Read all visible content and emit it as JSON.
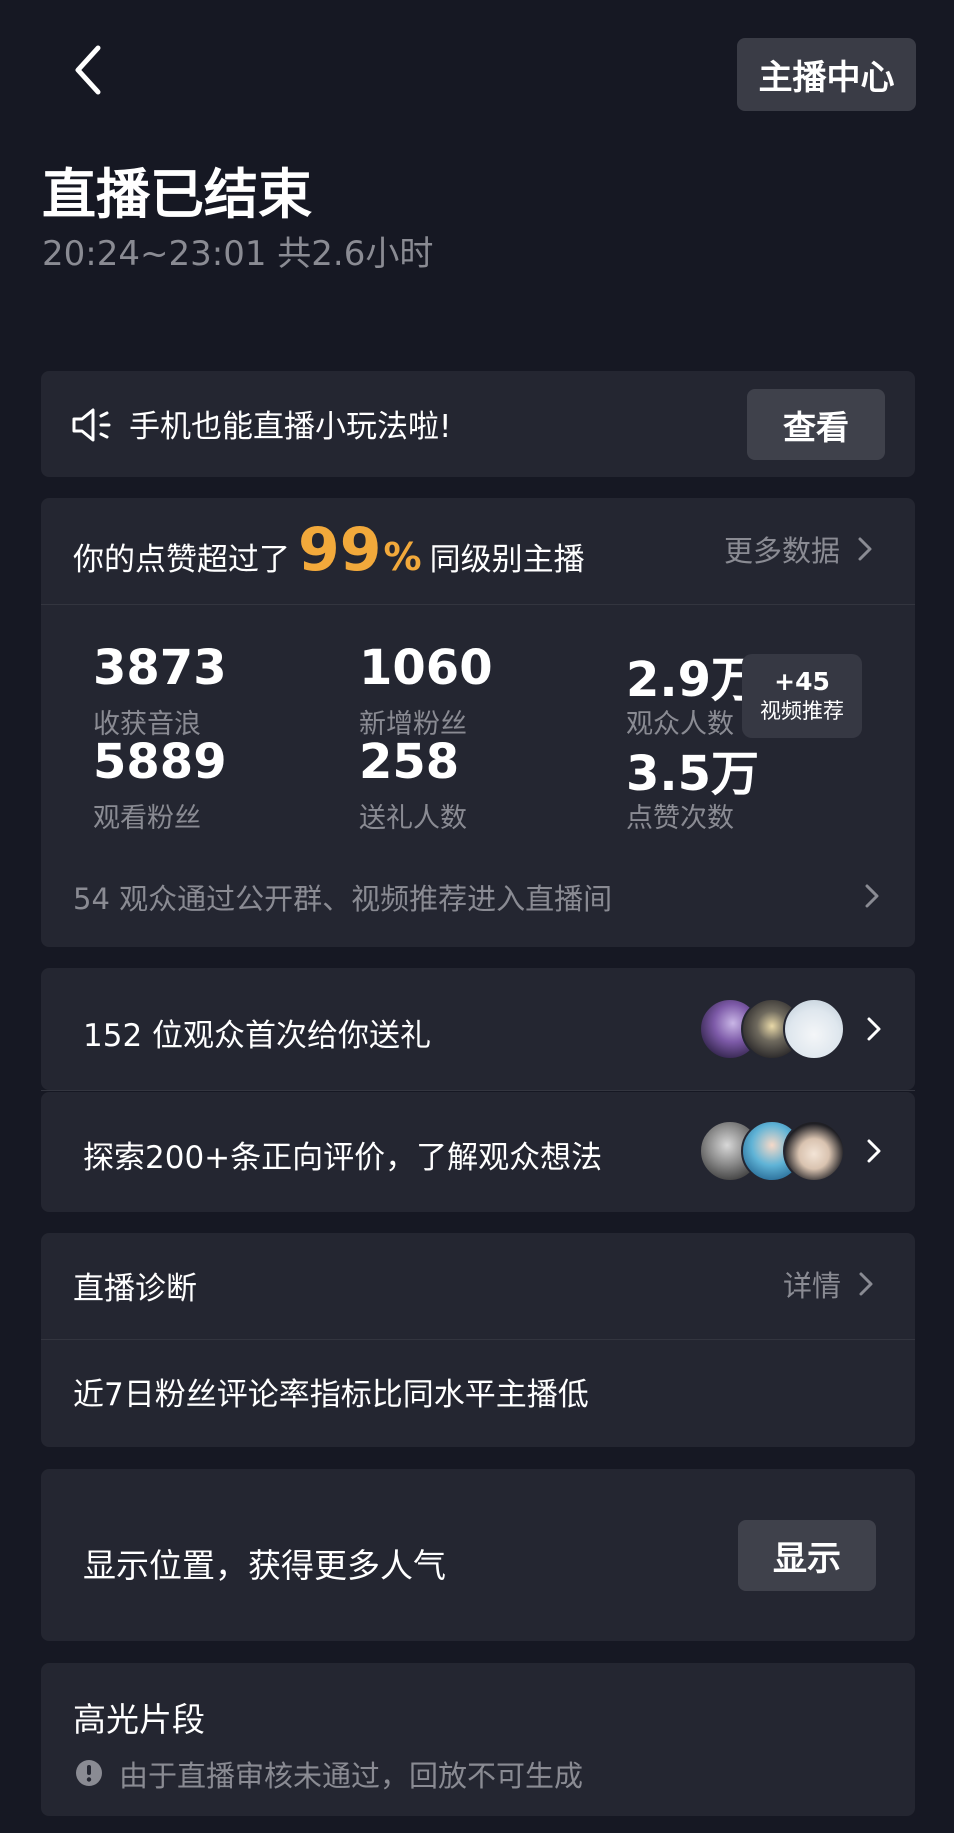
{
  "header": {
    "center_button": "主播中心",
    "title": "直播已结束",
    "subtitle": "20:24~23:01 共2.6小时"
  },
  "banner": {
    "text": "手机也能直播小玩法啦!",
    "button": "查看"
  },
  "stats": {
    "likes_prefix": "你的点赞超过了",
    "likes_percent": "99",
    "likes_percent_sign": "%",
    "likes_suffix": "同级别主播",
    "more_link": "更多数据",
    "items": [
      {
        "value": "3873",
        "label": "收获音浪"
      },
      {
        "value": "1060",
        "label": "新增粉丝"
      },
      {
        "value": "2.9万",
        "label": "观众人数"
      },
      {
        "value": "5889",
        "label": "观看粉丝"
      },
      {
        "value": "258",
        "label": "送礼人数"
      },
      {
        "value": "3.5万",
        "label": "点赞次数"
      }
    ],
    "badge": {
      "plus": "+45",
      "label": "视频推荐"
    },
    "route_text": "54 观众通过公开群、视频推荐进入直播间"
  },
  "gift_row": {
    "text": "152 位观众首次给你送礼"
  },
  "review_row": {
    "text": "探索200+条正向评价，了解观众想法"
  },
  "diagnosis": {
    "title": "直播诊断",
    "link": "详情",
    "message": "近7日粉丝评论率指标比同水平主播低"
  },
  "location": {
    "text": "显示位置，获得更多人气",
    "button": "显示"
  },
  "highlights": {
    "title": "高光片段",
    "message": "由于直播审核未通过，回放不可生成"
  },
  "colors": {
    "background": "#161823",
    "card": "#242631",
    "accent": "#f2a93b",
    "secondary_text": "#8a8b93"
  }
}
